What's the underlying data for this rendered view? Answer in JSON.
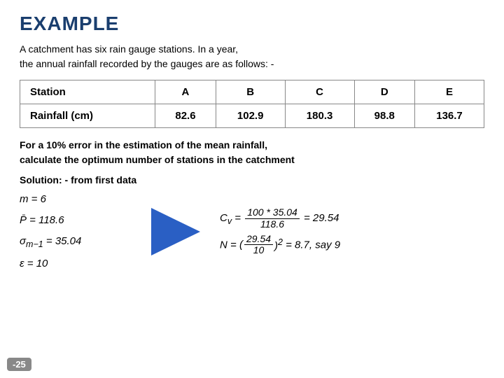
{
  "title": "EXAMPLE",
  "description_line1": "A catchment  has six rain gauge stations. In a year,",
  "description_line2": "the annual rainfall recorded by the gauges are as follows: -",
  "table": {
    "headers": [
      "Station",
      "A",
      "B",
      "C",
      "D",
      "E"
    ],
    "row": {
      "label": "Rainfall (cm)",
      "values": [
        "82.6",
        "102.9",
        "180.3",
        "98.8",
        "136.7"
      ]
    }
  },
  "problem_text_line1": "For a 10% error in the estimation  of the mean rainfall,",
  "problem_text_line2": "calculate the optimum number of stations in the catchment",
  "solution_label": "Solution: - from first data",
  "left_formulas": [
    "m = 6",
    "P̄ = 118.6",
    "σm−1 = 35.04",
    "ε = 10"
  ],
  "right_formula1": "Cv = (100 × 35.04) / 118.6 = 29.54",
  "right_formula2": "N = (29.54 / 10)² = 8.7, say 9",
  "badge": "-25"
}
